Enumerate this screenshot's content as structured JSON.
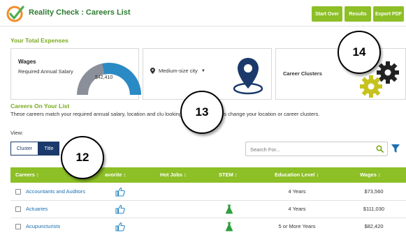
{
  "header": {
    "title": "Reality Check : Careers List",
    "buttons": {
      "start_over": "Start Over",
      "results": "Results",
      "export_pdf": "Export PDF"
    }
  },
  "expenses": {
    "title": "Your Total Expenses",
    "wages_card": {
      "title": "Wages",
      "subtitle": "Required Annual Salary",
      "gauge_value": "$42,410",
      "gauge_icon": "half-donut-gauge"
    },
    "location_card": {
      "selected": "Medium-size city",
      "icon": "map-pin-icon"
    },
    "clusters_card": {
      "label": "Career Clusters",
      "icon": "gears-icon"
    }
  },
  "careers": {
    "title": "Careers On Your List",
    "description": "These careers match your required annual salary, location and clu                         looking for different results change your location or career clusters."
  },
  "view": {
    "label": "View:",
    "options": [
      "Cluster",
      "Title"
    ],
    "selected": "Title"
  },
  "search": {
    "placeholder": "Search For..."
  },
  "table": {
    "columns": [
      "Careers ↕",
      "avorite ↕",
      "Hot Jobs ↕",
      "STEM ↕",
      "Education Level ↕",
      "Wages ↕"
    ],
    "rows": [
      {
        "career": "Accountants and Auditors",
        "favorite": true,
        "stem": false,
        "education": "4 Years",
        "wages": "$73,560"
      },
      {
        "career": "Actuaries",
        "favorite": true,
        "stem": true,
        "education": "4 Years",
        "wages": "$111,030"
      },
      {
        "career": "Acupuncturists",
        "favorite": true,
        "stem": true,
        "education": "5 or More Years",
        "wages": "$82,420"
      }
    ]
  },
  "callouts": [
    "12",
    "13",
    "14"
  ],
  "colors": {
    "accent_green": "#8dbf26",
    "navy": "#1b3a6b",
    "link_blue": "#1a6fb0",
    "gauge_blue": "#2a8ac4",
    "gauge_gray": "#8a8f99",
    "logo_orange": "#f28c28"
  }
}
